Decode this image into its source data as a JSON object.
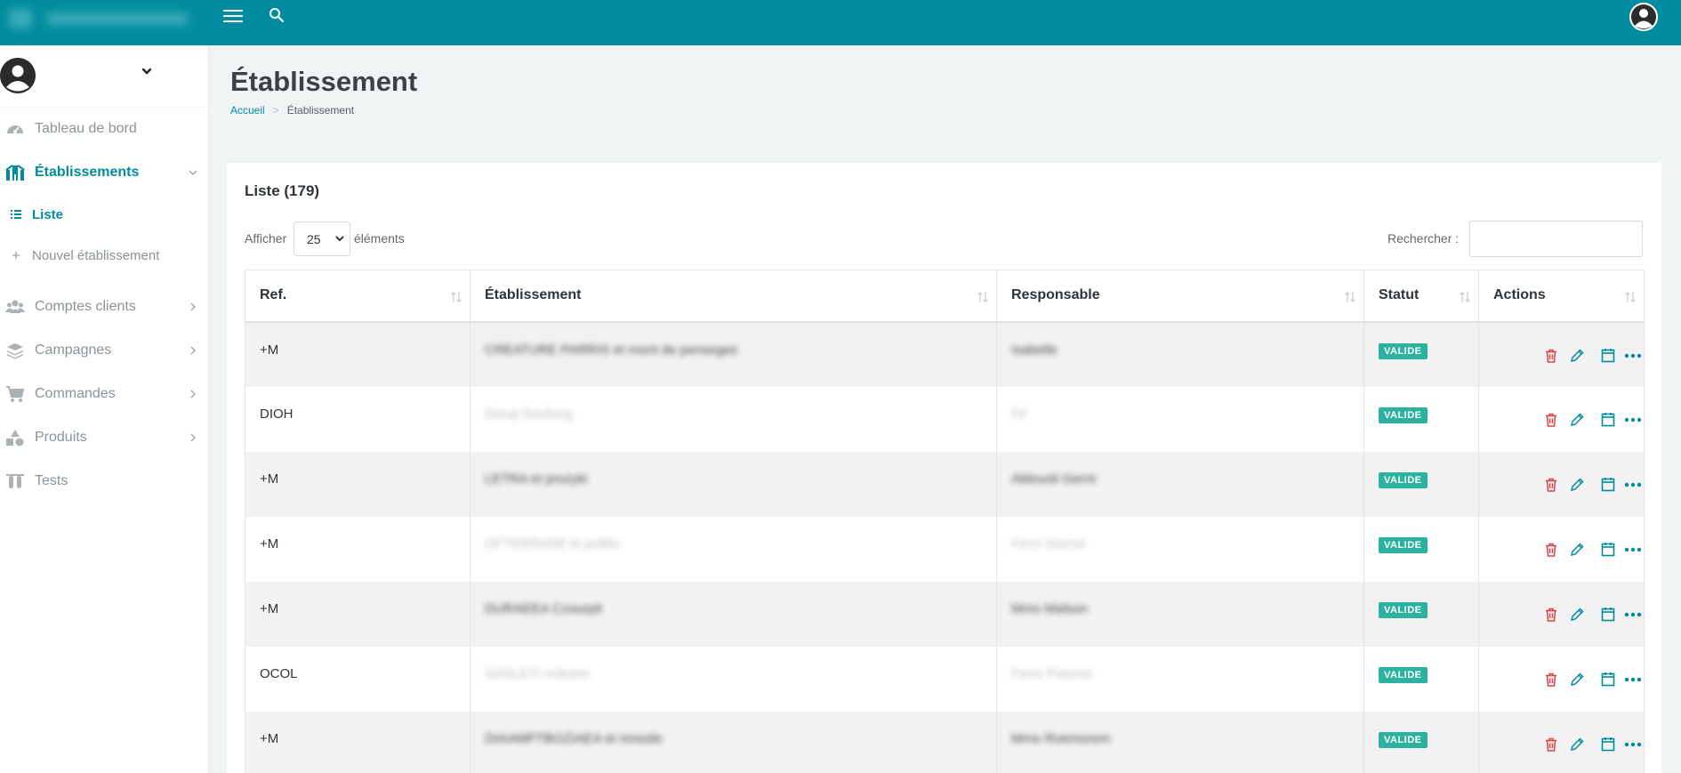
{
  "app": {
    "accent": "#008c9e",
    "badge_color": "#2bb3a0",
    "delete_color": "#e0404a"
  },
  "topbar": {
    "menu_icon": "hamburger-icon",
    "search_icon": "search-icon",
    "user_icon": "user-avatar-icon"
  },
  "sidebar": {
    "user_chevron_icon": "chevron-down-icon",
    "items": [
      {
        "label": "Tableau de bord",
        "icon": "dashboard-icon"
      },
      {
        "label": "Établissements",
        "icon": "building-icon",
        "active": true
      },
      {
        "label": "Comptes clients",
        "icon": "users-icon"
      },
      {
        "label": "Campagnes",
        "icon": "layers-icon"
      },
      {
        "label": "Commandes",
        "icon": "cart-icon"
      },
      {
        "label": "Produits",
        "icon": "shapes-icon"
      },
      {
        "label": "Tests",
        "icon": "test-tubes-icon"
      }
    ],
    "subitems": [
      {
        "label": "Liste",
        "icon": "list-icon",
        "active": true
      },
      {
        "label": "Nouvel établissement",
        "icon": "plus-icon"
      }
    ]
  },
  "page": {
    "title": "Établissement",
    "breadcrumb": {
      "home": "Accueil",
      "current": "Établissement"
    }
  },
  "list": {
    "title": "Liste (179)",
    "length_before": "Afficher",
    "length_value": "25",
    "length_after": "éléments",
    "search_label": "Rechercher :",
    "search_value": "",
    "columns": [
      "Ref.",
      "Établissement",
      "Responsable",
      "Statut",
      "Actions"
    ],
    "rows": [
      {
        "ref": "+M",
        "etab": "CREATURE PARRIS et mont de penseges",
        "resp": "Isabelle",
        "status": "VALIDE"
      },
      {
        "ref": "DIOH",
        "etab": "Dioup Dunloug",
        "resp": "Fil",
        "status": "VALIDE"
      },
      {
        "ref": "+M",
        "etab": "LETRA et prozyki",
        "resp": "Aldousti Gernt",
        "status": "VALIDE"
      },
      {
        "ref": "+M",
        "etab": "OFTERRARE le politio",
        "resp": "Ferm Derme",
        "status": "VALIDE"
      },
      {
        "ref": "+M",
        "etab": "DURAEEA Czourpit",
        "resp": "Mmo Malson",
        "status": "VALIDE"
      },
      {
        "ref": "OCOL",
        "etab": "SANLETI nolewm",
        "resp": "Ferre Paoroxi",
        "status": "VALIDE"
      },
      {
        "ref": "+M",
        "etab": "DIAAMPTBOZIAEA et mnosle",
        "resp": "Mmo Roemorem",
        "status": "VALIDE"
      }
    ],
    "action_icons": [
      "trash-icon",
      "pencil-icon",
      "calendar-icon",
      "more-icon"
    ]
  }
}
